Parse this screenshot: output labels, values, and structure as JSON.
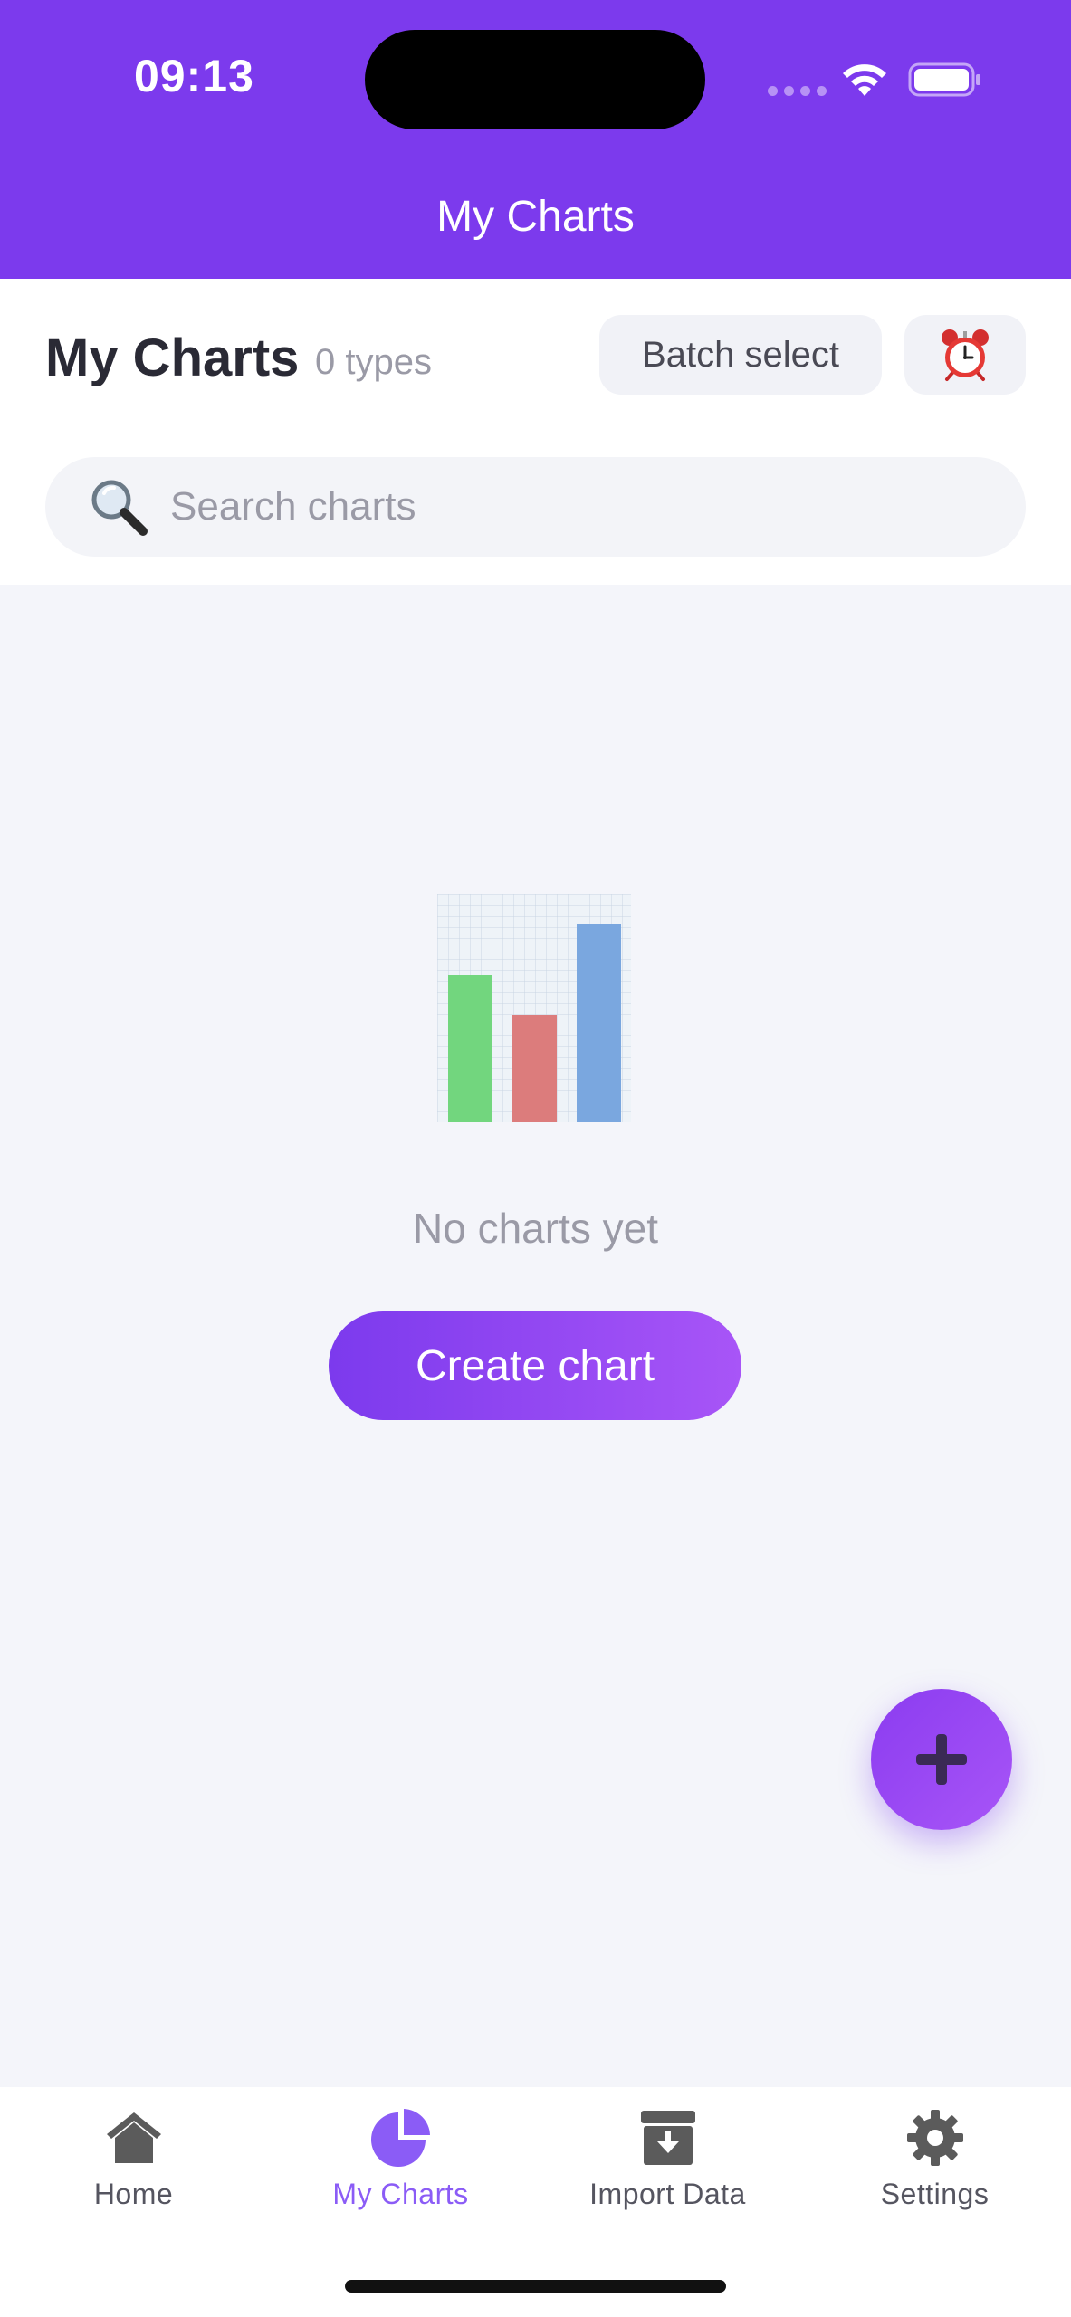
{
  "status_bar": {
    "time": "09:13"
  },
  "header": {
    "title": "My Charts"
  },
  "page": {
    "title": "My Charts",
    "type_count": "0 types",
    "batch_select_label": "Batch select"
  },
  "search": {
    "placeholder": "Search charts"
  },
  "empty_state": {
    "message": "No charts yet",
    "create_label": "Create chart"
  },
  "tabs": [
    {
      "label": "Home",
      "icon": "home-icon",
      "active": false
    },
    {
      "label": "My Charts",
      "icon": "pie-chart-icon",
      "active": true
    },
    {
      "label": "Import Data",
      "icon": "import-icon",
      "active": false
    },
    {
      "label": "Settings",
      "icon": "gear-icon",
      "active": false
    }
  ],
  "colors": {
    "accent": "#7c3aed",
    "accent_light": "#a855f7",
    "active_tab": "#8b5cf6",
    "background": "#f4f5fa"
  }
}
